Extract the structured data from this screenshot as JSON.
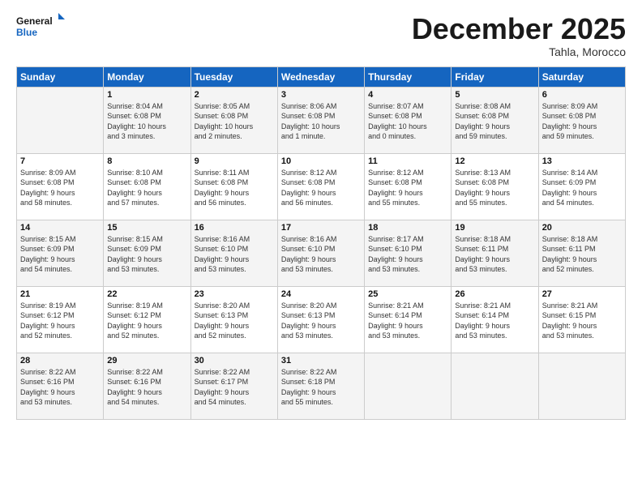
{
  "logo": {
    "line1": "General",
    "line2": "Blue"
  },
  "title": "December 2025",
  "subtitle": "Tahla, Morocco",
  "weekdays": [
    "Sunday",
    "Monday",
    "Tuesday",
    "Wednesday",
    "Thursday",
    "Friday",
    "Saturday"
  ],
  "weeks": [
    [
      {
        "day": "",
        "info": ""
      },
      {
        "day": "1",
        "info": "Sunrise: 8:04 AM\nSunset: 6:08 PM\nDaylight: 10 hours\nand 3 minutes."
      },
      {
        "day": "2",
        "info": "Sunrise: 8:05 AM\nSunset: 6:08 PM\nDaylight: 10 hours\nand 2 minutes."
      },
      {
        "day": "3",
        "info": "Sunrise: 8:06 AM\nSunset: 6:08 PM\nDaylight: 10 hours\nand 1 minute."
      },
      {
        "day": "4",
        "info": "Sunrise: 8:07 AM\nSunset: 6:08 PM\nDaylight: 10 hours\nand 0 minutes."
      },
      {
        "day": "5",
        "info": "Sunrise: 8:08 AM\nSunset: 6:08 PM\nDaylight: 9 hours\nand 59 minutes."
      },
      {
        "day": "6",
        "info": "Sunrise: 8:09 AM\nSunset: 6:08 PM\nDaylight: 9 hours\nand 59 minutes."
      }
    ],
    [
      {
        "day": "7",
        "info": "Sunrise: 8:09 AM\nSunset: 6:08 PM\nDaylight: 9 hours\nand 58 minutes."
      },
      {
        "day": "8",
        "info": "Sunrise: 8:10 AM\nSunset: 6:08 PM\nDaylight: 9 hours\nand 57 minutes."
      },
      {
        "day": "9",
        "info": "Sunrise: 8:11 AM\nSunset: 6:08 PM\nDaylight: 9 hours\nand 56 minutes."
      },
      {
        "day": "10",
        "info": "Sunrise: 8:12 AM\nSunset: 6:08 PM\nDaylight: 9 hours\nand 56 minutes."
      },
      {
        "day": "11",
        "info": "Sunrise: 8:12 AM\nSunset: 6:08 PM\nDaylight: 9 hours\nand 55 minutes."
      },
      {
        "day": "12",
        "info": "Sunrise: 8:13 AM\nSunset: 6:08 PM\nDaylight: 9 hours\nand 55 minutes."
      },
      {
        "day": "13",
        "info": "Sunrise: 8:14 AM\nSunset: 6:09 PM\nDaylight: 9 hours\nand 54 minutes."
      }
    ],
    [
      {
        "day": "14",
        "info": "Sunrise: 8:15 AM\nSunset: 6:09 PM\nDaylight: 9 hours\nand 54 minutes."
      },
      {
        "day": "15",
        "info": "Sunrise: 8:15 AM\nSunset: 6:09 PM\nDaylight: 9 hours\nand 53 minutes."
      },
      {
        "day": "16",
        "info": "Sunrise: 8:16 AM\nSunset: 6:10 PM\nDaylight: 9 hours\nand 53 minutes."
      },
      {
        "day": "17",
        "info": "Sunrise: 8:16 AM\nSunset: 6:10 PM\nDaylight: 9 hours\nand 53 minutes."
      },
      {
        "day": "18",
        "info": "Sunrise: 8:17 AM\nSunset: 6:10 PM\nDaylight: 9 hours\nand 53 minutes."
      },
      {
        "day": "19",
        "info": "Sunrise: 8:18 AM\nSunset: 6:11 PM\nDaylight: 9 hours\nand 53 minutes."
      },
      {
        "day": "20",
        "info": "Sunrise: 8:18 AM\nSunset: 6:11 PM\nDaylight: 9 hours\nand 52 minutes."
      }
    ],
    [
      {
        "day": "21",
        "info": "Sunrise: 8:19 AM\nSunset: 6:12 PM\nDaylight: 9 hours\nand 52 minutes."
      },
      {
        "day": "22",
        "info": "Sunrise: 8:19 AM\nSunset: 6:12 PM\nDaylight: 9 hours\nand 52 minutes."
      },
      {
        "day": "23",
        "info": "Sunrise: 8:20 AM\nSunset: 6:13 PM\nDaylight: 9 hours\nand 52 minutes."
      },
      {
        "day": "24",
        "info": "Sunrise: 8:20 AM\nSunset: 6:13 PM\nDaylight: 9 hours\nand 53 minutes."
      },
      {
        "day": "25",
        "info": "Sunrise: 8:21 AM\nSunset: 6:14 PM\nDaylight: 9 hours\nand 53 minutes."
      },
      {
        "day": "26",
        "info": "Sunrise: 8:21 AM\nSunset: 6:14 PM\nDaylight: 9 hours\nand 53 minutes."
      },
      {
        "day": "27",
        "info": "Sunrise: 8:21 AM\nSunset: 6:15 PM\nDaylight: 9 hours\nand 53 minutes."
      }
    ],
    [
      {
        "day": "28",
        "info": "Sunrise: 8:22 AM\nSunset: 6:16 PM\nDaylight: 9 hours\nand 53 minutes."
      },
      {
        "day": "29",
        "info": "Sunrise: 8:22 AM\nSunset: 6:16 PM\nDaylight: 9 hours\nand 54 minutes."
      },
      {
        "day": "30",
        "info": "Sunrise: 8:22 AM\nSunset: 6:17 PM\nDaylight: 9 hours\nand 54 minutes."
      },
      {
        "day": "31",
        "info": "Sunrise: 8:22 AM\nSunset: 6:18 PM\nDaylight: 9 hours\nand 55 minutes."
      },
      {
        "day": "",
        "info": ""
      },
      {
        "day": "",
        "info": ""
      },
      {
        "day": "",
        "info": ""
      }
    ]
  ]
}
